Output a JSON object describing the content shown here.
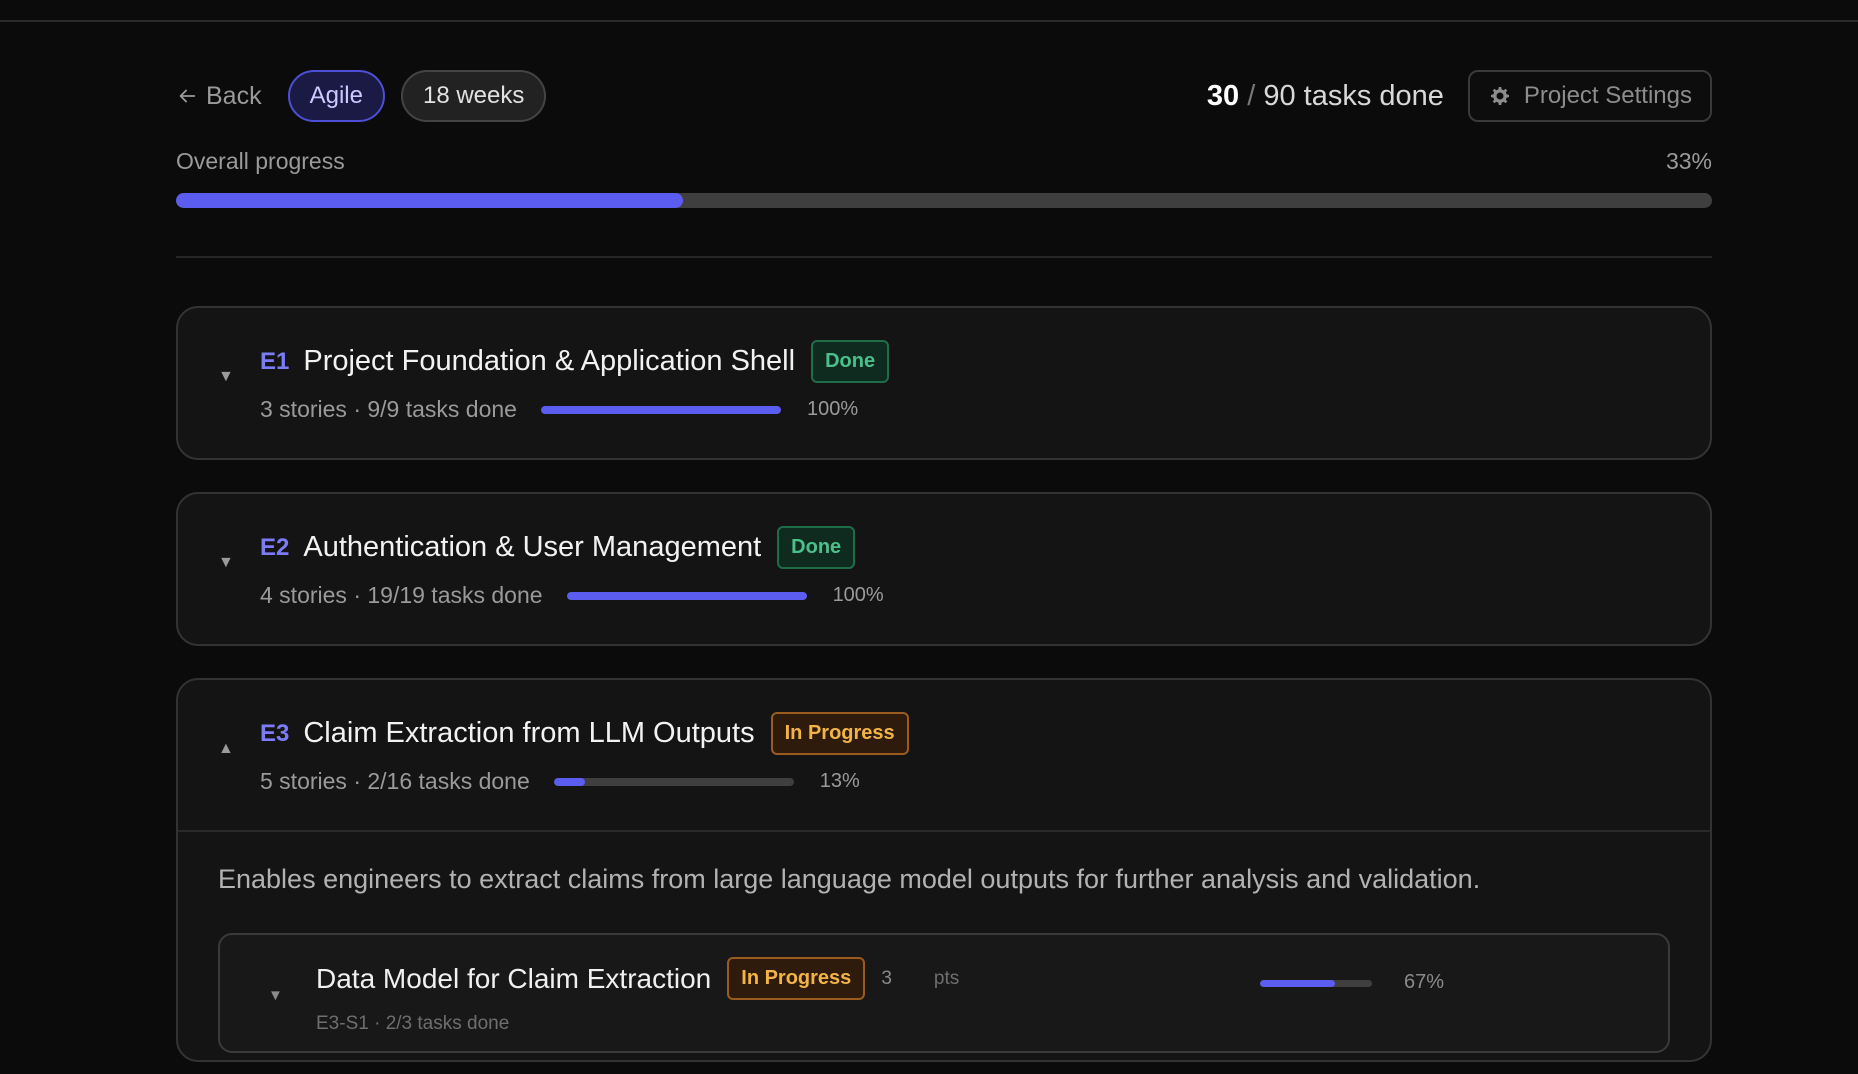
{
  "header": {
    "back_label": "Back",
    "methodology": "Agile",
    "duration": "18 weeks",
    "tasks_done_count": "30",
    "tasks_done_separator": "/",
    "tasks_total_label": "90 tasks done",
    "settings_label": "Project Settings"
  },
  "overall": {
    "label": "Overall progress",
    "percent_label": "33%",
    "fraction": 0.33
  },
  "colors": {
    "accent": "#5b5cf0",
    "done": "#4cc08a",
    "in_progress": "#f3b447"
  },
  "epics": [
    {
      "id": "E1",
      "name": "Project Foundation & Application Shell",
      "status": "Done",
      "meta": "3 stories · 9/9 tasks done",
      "percent_label": "100%",
      "fraction": 1.0,
      "expanded": false
    },
    {
      "id": "E2",
      "name": "Authentication & User Management",
      "status": "Done",
      "meta": "4 stories · 19/19 tasks done",
      "percent_label": "100%",
      "fraction": 1.0,
      "expanded": false
    },
    {
      "id": "E3",
      "name": "Claim Extraction from LLM Outputs",
      "status": "In Progress",
      "meta": "5 stories · 2/16 tasks done",
      "percent_label": "13%",
      "fraction": 0.13,
      "expanded": true,
      "description": "Enables engineers to extract claims from large language model outputs for further analysis and validation.",
      "stories": [
        {
          "name": "Data Model for Claim Extraction",
          "status": "In Progress",
          "points": "3",
          "points_label": "pts",
          "meta": "E3-S1 · 2/3 tasks done",
          "percent_label": "67%",
          "fraction": 0.67
        }
      ]
    }
  ]
}
